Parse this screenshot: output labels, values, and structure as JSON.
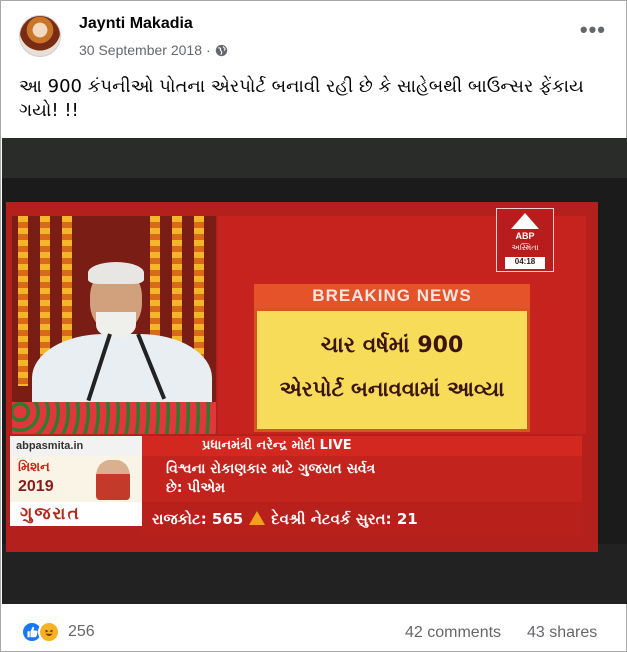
{
  "post": {
    "author": "Jaynti Makadia",
    "date": "30 September 2018",
    "separator": "·",
    "privacy_icon": "globe-icon",
    "more_icon": "more-options-icon",
    "more_glyph": "•••",
    "caption": "આ 900 કંપનીઓ પોતના એરપોર્ટ બનાવી રહી છે કે સાહેબથી બાઉન્સર ફેંકાય ગયો! !!"
  },
  "image": {
    "logo": {
      "brand": "ABP",
      "name": "અસ્મિતા",
      "time": "04:18"
    },
    "breaking_label": "BREAKING NEWS",
    "breaking_line1": "ચાર વર્ષમાં 900",
    "breaking_line2": "એરપોર્ટ બનાવવામાં આવ્યા",
    "url_strip": "abpasmita.in",
    "live_bar": "પ્રધાનમંત્રી નરેન્દ્ર મોદી LIVE",
    "symbol_title": "મિશન",
    "symbol_year": "2019",
    "headline_line1": "વિશ્વના રોકાણકાર માટે ગુજરાત સર્વત્ર",
    "headline_line2": "છે: પીએમ",
    "state_label": "ગુજરાત",
    "ticker_left": "રાજકોટ: 565",
    "ticker_right": "દેવશ્રી નેટવર્ક સુરત: 21"
  },
  "footer": {
    "reaction_icons": [
      "like-icon",
      "haha-icon"
    ],
    "reaction_count": "256",
    "comments": "42 comments",
    "shares": "43 shares"
  },
  "colors": {
    "brand_blue": "#1877f2",
    "news_red": "#c6231e",
    "breaking_yellow": "#f7dc5a"
  }
}
